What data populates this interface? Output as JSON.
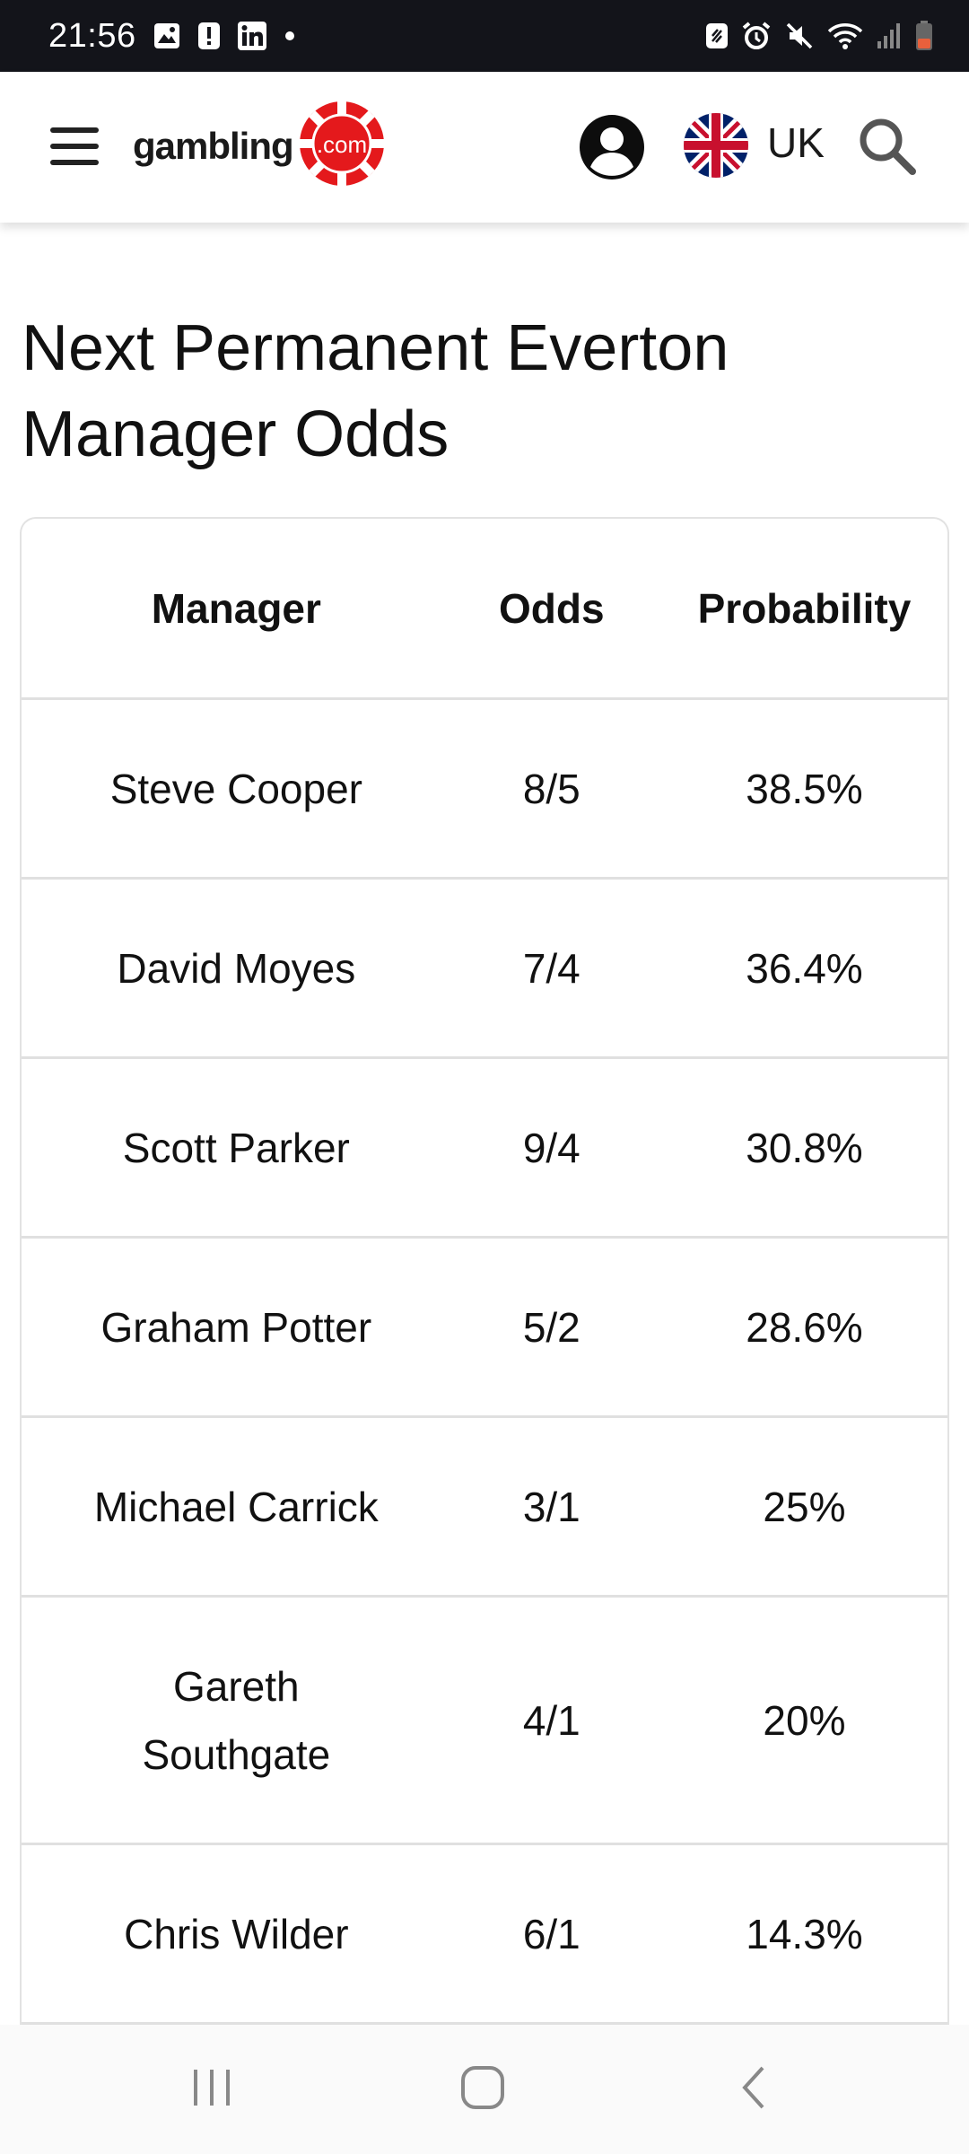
{
  "status_bar": {
    "time": "21:56",
    "icons_left": [
      "gallery-icon",
      "alert-icon",
      "linkedin-icon",
      "dot-icon"
    ],
    "icons_right": [
      "nfc-icon",
      "alarm-icon",
      "mute-icon",
      "wifi-icon",
      "signal-icon",
      "battery-icon"
    ]
  },
  "header": {
    "logo_text": "gambling",
    "logo_chip_text": ".com",
    "region": "UK",
    "brand_color": "#e4191c"
  },
  "page": {
    "title_line1": "Next Permanent Everton",
    "title_line2": "Manager Odds"
  },
  "table": {
    "columns": [
      "Manager",
      "Odds",
      "Probability"
    ],
    "rows": [
      {
        "manager": "Steve Cooper",
        "odds": "8/5",
        "probability": "38.5%"
      },
      {
        "manager": "David Moyes",
        "odds": "7/4",
        "probability": "36.4%"
      },
      {
        "manager": "Scott Parker",
        "odds": "9/4",
        "probability": "30.8%"
      },
      {
        "manager": "Graham Potter",
        "odds": "5/2",
        "probability": "28.6%"
      },
      {
        "manager": "Michael Carrick",
        "odds": "3/1",
        "probability": "25%"
      },
      {
        "manager": "Gareth Southgate",
        "odds": "4/1",
        "probability": "20%"
      },
      {
        "manager": "Chris Wilder",
        "odds": "6/1",
        "probability": "14.3%"
      }
    ]
  },
  "nav": {
    "icons": [
      "recents-icon",
      "home-icon",
      "back-icon"
    ]
  }
}
